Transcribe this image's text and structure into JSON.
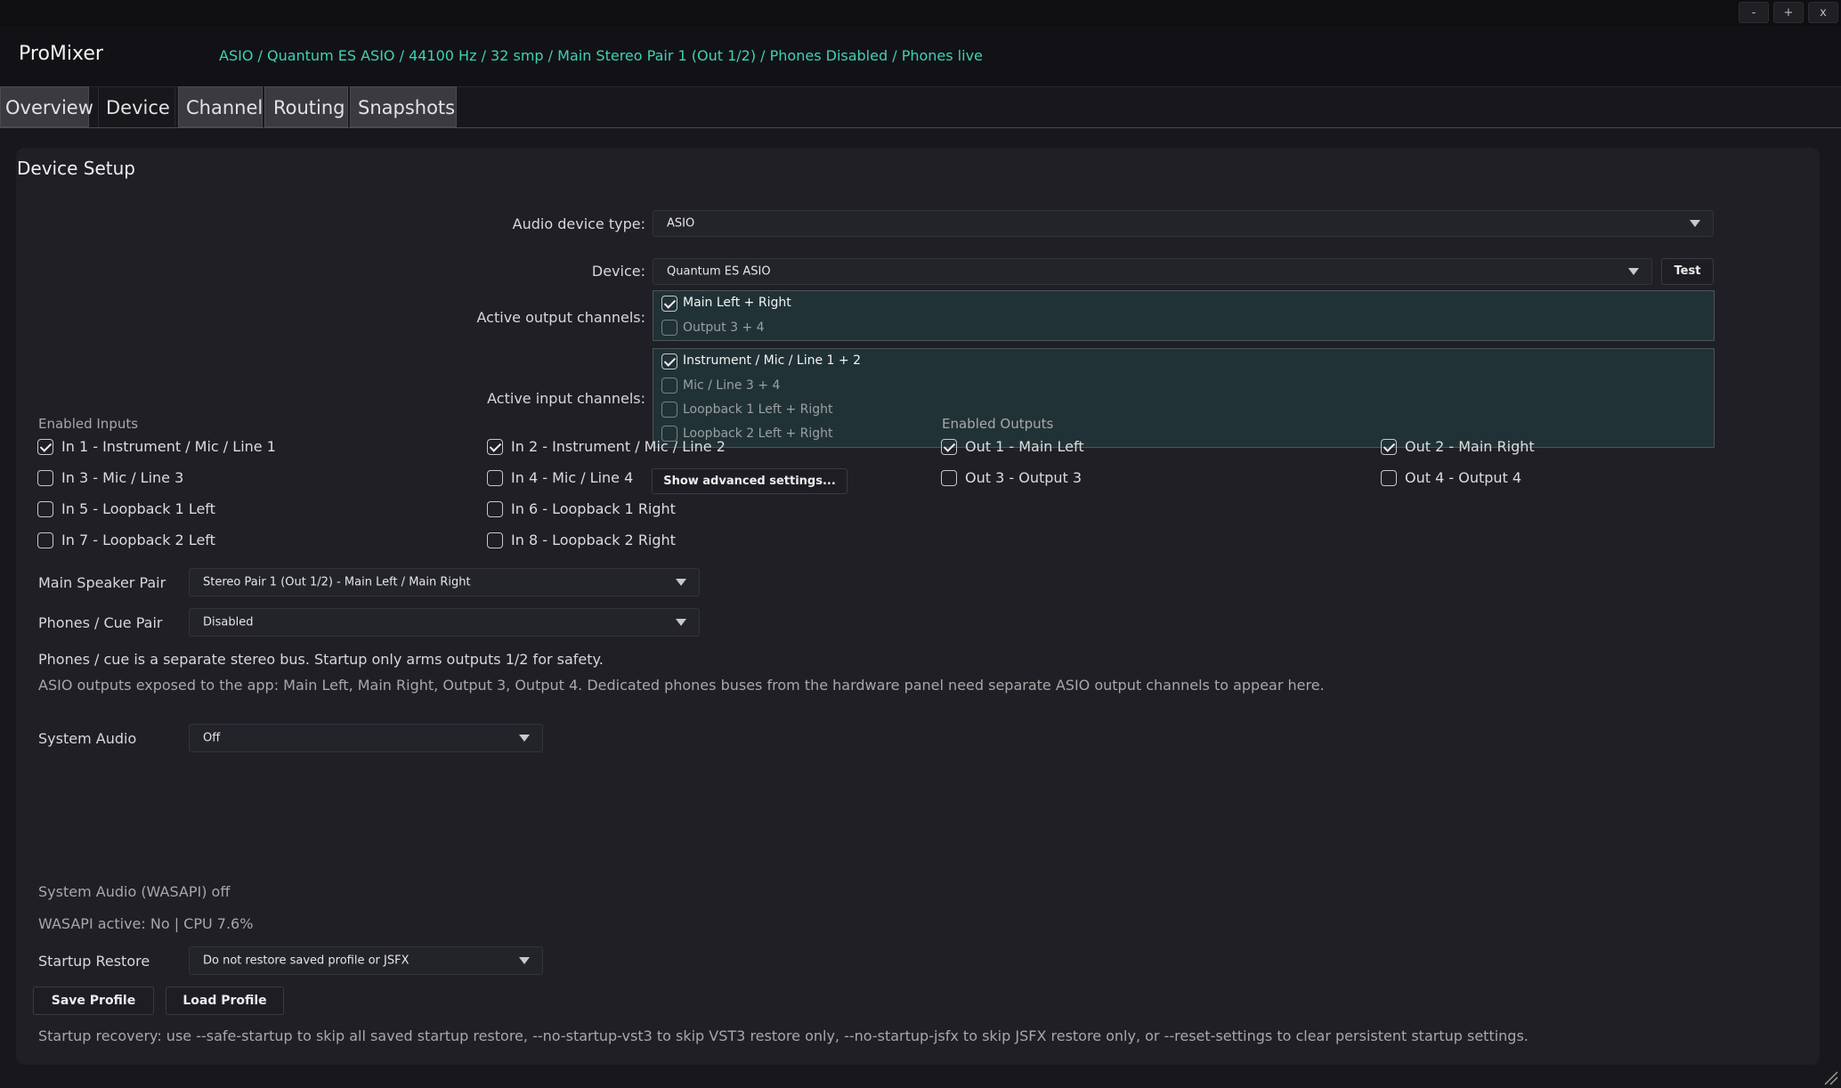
{
  "window": {
    "minimize": "-",
    "maximize": "+",
    "close": "x"
  },
  "header": {
    "app_name": "ProMixer",
    "status": "ASIO / Quantum ES ASIO / 44100 Hz / 32 smp / Main Stereo Pair 1 (Out 1/2) / Phones Disabled / Phones live"
  },
  "tabs": [
    "Overview",
    "Device",
    "Channel",
    "Routing",
    "Snapshots"
  ],
  "active_tab": "Device",
  "device_setup": {
    "title": "Device Setup",
    "audio_device_type_label": "Audio device type:",
    "audio_device_type_value": "ASIO",
    "device_label": "Device:",
    "device_value": "Quantum ES ASIO",
    "test_button": "Test",
    "active_output_label": "Active output channels:",
    "active_outputs": [
      {
        "label": "Main Left + Right",
        "checked": true
      },
      {
        "label": "Output 3 + 4",
        "checked": false
      }
    ],
    "active_input_label": "Active input channels:",
    "active_inputs": [
      {
        "label": "Instrument / Mic / Line 1 + 2",
        "checked": true
      },
      {
        "label": "Mic / Line 3 + 4",
        "checked": false
      },
      {
        "label": "Loopback 1 Left + Right",
        "checked": false
      },
      {
        "label": "Loopback 2 Left + Right",
        "checked": false
      }
    ]
  },
  "enabled_inputs": {
    "heading": "Enabled Inputs",
    "items": [
      {
        "label": "In 1 - Instrument / Mic / Line 1",
        "checked": true
      },
      {
        "label": "In 2 - Instrument / Mic / Line 2",
        "checked": true
      },
      {
        "label": "In 3 - Mic / Line 3",
        "checked": false
      },
      {
        "label": "In 4 - Mic / Line 4",
        "checked": false
      },
      {
        "label": "In 5 - Loopback 1 Left",
        "checked": false
      },
      {
        "label": "In 6 - Loopback 1 Right",
        "checked": false
      },
      {
        "label": "In 7 - Loopback 2 Left",
        "checked": false
      },
      {
        "label": "In 8 - Loopback 2 Right",
        "checked": false
      }
    ]
  },
  "advanced_button": "Show advanced settings...",
  "enabled_outputs": {
    "heading": "Enabled Outputs",
    "items": [
      {
        "label": "Out 1 - Main Left",
        "checked": true
      },
      {
        "label": "Out 2 - Main Right",
        "checked": true
      },
      {
        "label": "Out 3 - Output 3",
        "checked": false
      },
      {
        "label": "Out 4 - Output 4",
        "checked": false
      }
    ]
  },
  "speaker": {
    "main_label": "Main Speaker Pair",
    "main_value": "Stereo Pair 1 (Out 1/2) - Main Left / Main Right",
    "phones_label": "Phones / Cue Pair",
    "phones_value": "Disabled",
    "note1": "Phones / cue is a separate stereo bus. Startup only arms outputs 1/2 for safety.",
    "note2": "ASIO outputs exposed to the app: Main Left, Main Right, Output 3, Output 4. Dedicated phones buses from the hardware panel need separate ASIO output channels to appear here."
  },
  "system_audio": {
    "label": "System Audio",
    "value": "Off",
    "status": "System Audio (WASAPI) off",
    "wasapi": "WASAPI active: No | CPU 7.6%"
  },
  "startup": {
    "label": "Startup Restore",
    "value": "Do not restore saved profile or JSFX",
    "save_button": "Save Profile",
    "load_button": "Load Profile",
    "recovery": "Startup recovery: use --safe-startup to skip all saved startup restore, --no-startup-vst3 to skip VST3 restore only, --no-startup-jsfx to skip JSFX restore only, or --reset-settings to clear persistent startup settings."
  }
}
